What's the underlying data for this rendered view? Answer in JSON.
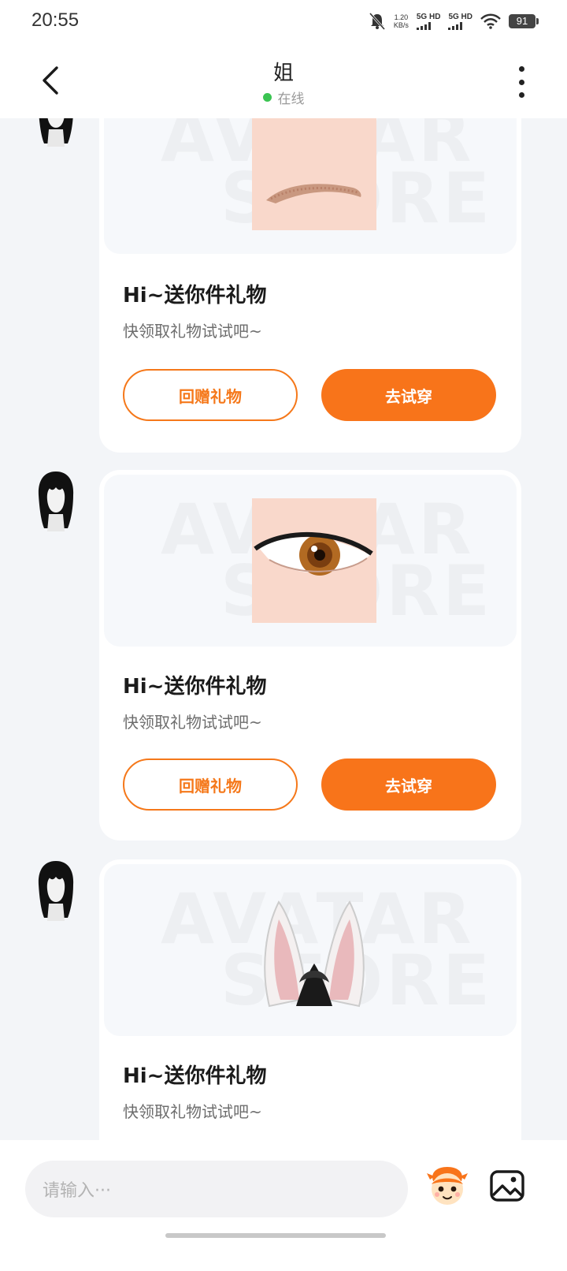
{
  "status_bar": {
    "time": "20:55",
    "net_speed_value": "1.20",
    "net_speed_unit": "KB/s",
    "sim1": "5G HD",
    "sim2": "5G HD",
    "battery": "91"
  },
  "header": {
    "title": "姐",
    "status_text": "在线",
    "status_color": "#3bc452"
  },
  "watermark": {
    "line1": "AVATAR",
    "line2": "STORE"
  },
  "messages": [
    {
      "gift_item": "eyebrow",
      "title": "Hi~送你件礼物",
      "subtitle": "快领取礼物试试吧~",
      "return_gift_label": "回赠礼物",
      "try_on_label": "去试穿"
    },
    {
      "gift_item": "eye",
      "title": "Hi~送你件礼物",
      "subtitle": "快领取礼物试试吧~",
      "return_gift_label": "回赠礼物",
      "try_on_label": "去试穿"
    },
    {
      "gift_item": "animal-ears",
      "title": "Hi~送你件礼物",
      "subtitle": "快领取礼物试试吧~"
    }
  ],
  "input": {
    "placeholder": "请输入···"
  },
  "icons": {
    "back": "chevron-left-icon",
    "more": "more-vertical-icon",
    "mascot": "mascot-sticker-icon",
    "image": "image-icon"
  },
  "colors": {
    "accent": "#f8741a",
    "background": "#f3f5f8"
  }
}
